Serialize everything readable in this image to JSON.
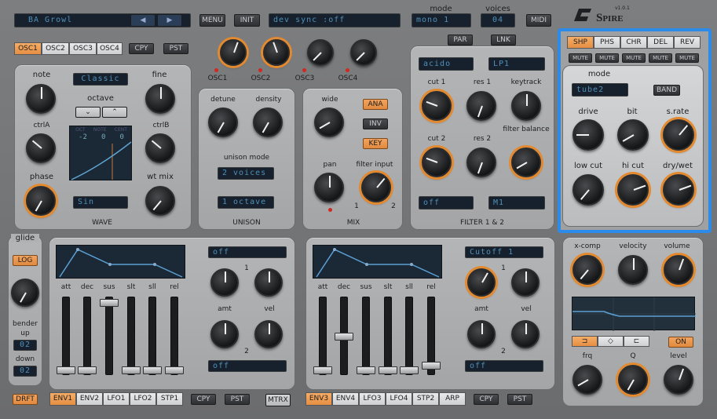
{
  "header": {
    "preset_name": "BA Growl",
    "menu": "MENU",
    "init": "INIT",
    "status": "dev sync    :off",
    "mode_label": "mode",
    "mode_value": "mono 1",
    "voices_label": "voices",
    "voices_value": "04",
    "midi": "MIDI",
    "logo": "Spire",
    "version": "v1.0.1"
  },
  "osc_tabs": [
    "OSC1",
    "OSC2",
    "OSC3",
    "OSC4"
  ],
  "cpy": "CPY",
  "pst": "PST",
  "osc_knobs": [
    "OSC1",
    "OSC2",
    "OSC3",
    "OSC4"
  ],
  "osc": {
    "note": "note",
    "fine": "fine",
    "mode": "Classic",
    "octave": "octave",
    "ctrlA": "ctrlA",
    "ctrlB": "ctrlB",
    "phase": "phase",
    "wtmix": "wt mix",
    "wave_select": "Sin",
    "title": "WAVE",
    "scope": {
      "h1": "OCT",
      "h2": "NOTE",
      "h3": "CENT",
      "v1": "-2",
      "v2": "0",
      "v3": "0"
    }
  },
  "unison": {
    "detune": "detune",
    "density": "density",
    "mode_label": "unison mode",
    "voices": "2 voices",
    "octave": "1 octave",
    "title": "UNISON"
  },
  "mix": {
    "wide": "wide",
    "pan": "pan",
    "filter_input": "filter input",
    "ana": "ANA",
    "inv": "INV",
    "key": "KEY",
    "title": "MIX",
    "one": "1",
    "two": "2"
  },
  "filter": {
    "par": "PAR",
    "lnk": "LNK",
    "type1": "acido",
    "type2": "LP1",
    "cut1": "cut 1",
    "res1": "res 1",
    "keytrack": "keytrack",
    "cut2": "cut 2",
    "res2": "res 2",
    "balance": "filter balance",
    "sel1": "off",
    "sel2": "M1",
    "title": "FILTER 1 & 2"
  },
  "fx": {
    "tabs": [
      "SHP",
      "PHS",
      "CHR",
      "DEL",
      "REV"
    ],
    "mute": "MUTE",
    "mode_label": "mode",
    "mode_value": "tube2",
    "band": "BAND",
    "drive": "drive",
    "bit": "bit",
    "srate": "s.rate",
    "lowcut": "low cut",
    "hicut": "hi cut",
    "drywet": "dry/wet"
  },
  "glide": {
    "label": "glide",
    "log": "LOG",
    "bender": "bender",
    "up": "up",
    "up_val": "02",
    "down": "down",
    "down_val": "02"
  },
  "env1": {
    "labels": [
      "att",
      "dec",
      "sus",
      "slt",
      "sll",
      "rel"
    ],
    "dest1": "off",
    "dest2": "off",
    "amt": "amt",
    "vel": "vel",
    "one": "1",
    "two": "2"
  },
  "env2": {
    "labels": [
      "att",
      "dec",
      "sus",
      "slt",
      "sll",
      "rel"
    ],
    "dest1": "Cutoff 1",
    "dest2": "off",
    "amt": "amt",
    "vel": "vel",
    "one": "1",
    "two": "2"
  },
  "bottom_tabs1": [
    "ENV1",
    "ENV2",
    "LFO1",
    "LFO2",
    "STP1"
  ],
  "bottom_tabs2": [
    "ENV3",
    "ENV4",
    "LFO3",
    "LFO4",
    "STP2",
    "ARP"
  ],
  "drft": "DRFT",
  "mtrx": "MTRX",
  "eq": {
    "xcomp": "x-comp",
    "velocity": "velocity",
    "volume": "volume",
    "on": "ON",
    "frq": "frq",
    "q": "Q",
    "level": "level"
  }
}
